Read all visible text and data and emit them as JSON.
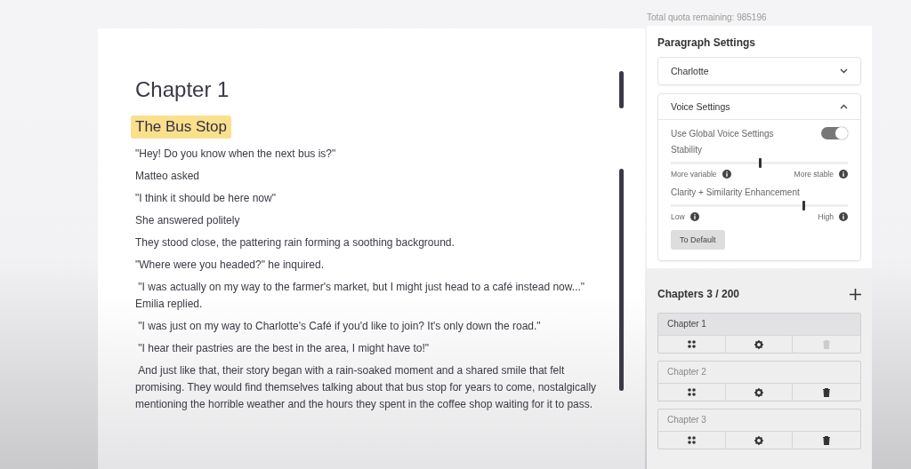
{
  "quota": "Total quota remaining: 985196",
  "editor": {
    "title": "Chapter 1",
    "subtitle": "The Bus Stop",
    "paragraphs": [
      "\"Hey! Do you know when the next bus is?\"",
      "Matteo asked",
      "\"I think it should be here now\"",
      "She answered politely",
      "They stood close, the pattering rain forming a soothing background.",
      "\"Where were you headed?\" he inquired.",
      " \"I was actually on my way to the farmer's market, but I might just head to a café instead now...\" Emilia replied.",
      " \"I was just on my way to Charlotte's Café if you'd like to join? It's only down the road.\"",
      " \"I hear their pastries are the best in the area, I might have to!\"",
      " And just like that, their story began with a rain-soaked moment and a shared smile that felt promising. They would find themselves talking about that bus stop for years to come, nostalgically mentioning the horrible weather and the hours they spent in the coffee shop waiting for it to pass."
    ]
  },
  "paragraph_settings": {
    "title": "Paragraph Settings",
    "voice": "Charlotte",
    "voice_settings": {
      "title": "Voice Settings",
      "expanded": true,
      "global_label": "Use Global Voice Settings",
      "global_on": true,
      "sliders": [
        {
          "label": "Stability",
          "level": 0.5,
          "min_label": "More variable",
          "max_label": "More stable"
        },
        {
          "label": "Clarity + Similarity Enhancement",
          "level": 0.75,
          "min_label": "Low",
          "max_label": "High"
        }
      ],
      "reset_button": "To Default"
    }
  },
  "chapters": {
    "title": "Chapters 3 / 200",
    "items": [
      {
        "name": "Chapter 1",
        "selected": true,
        "delete_disabled": true
      },
      {
        "name": "Chapter 2",
        "selected": false,
        "delete_disabled": false
      },
      {
        "name": "Chapter 3",
        "selected": false,
        "delete_disabled": false
      }
    ]
  }
}
